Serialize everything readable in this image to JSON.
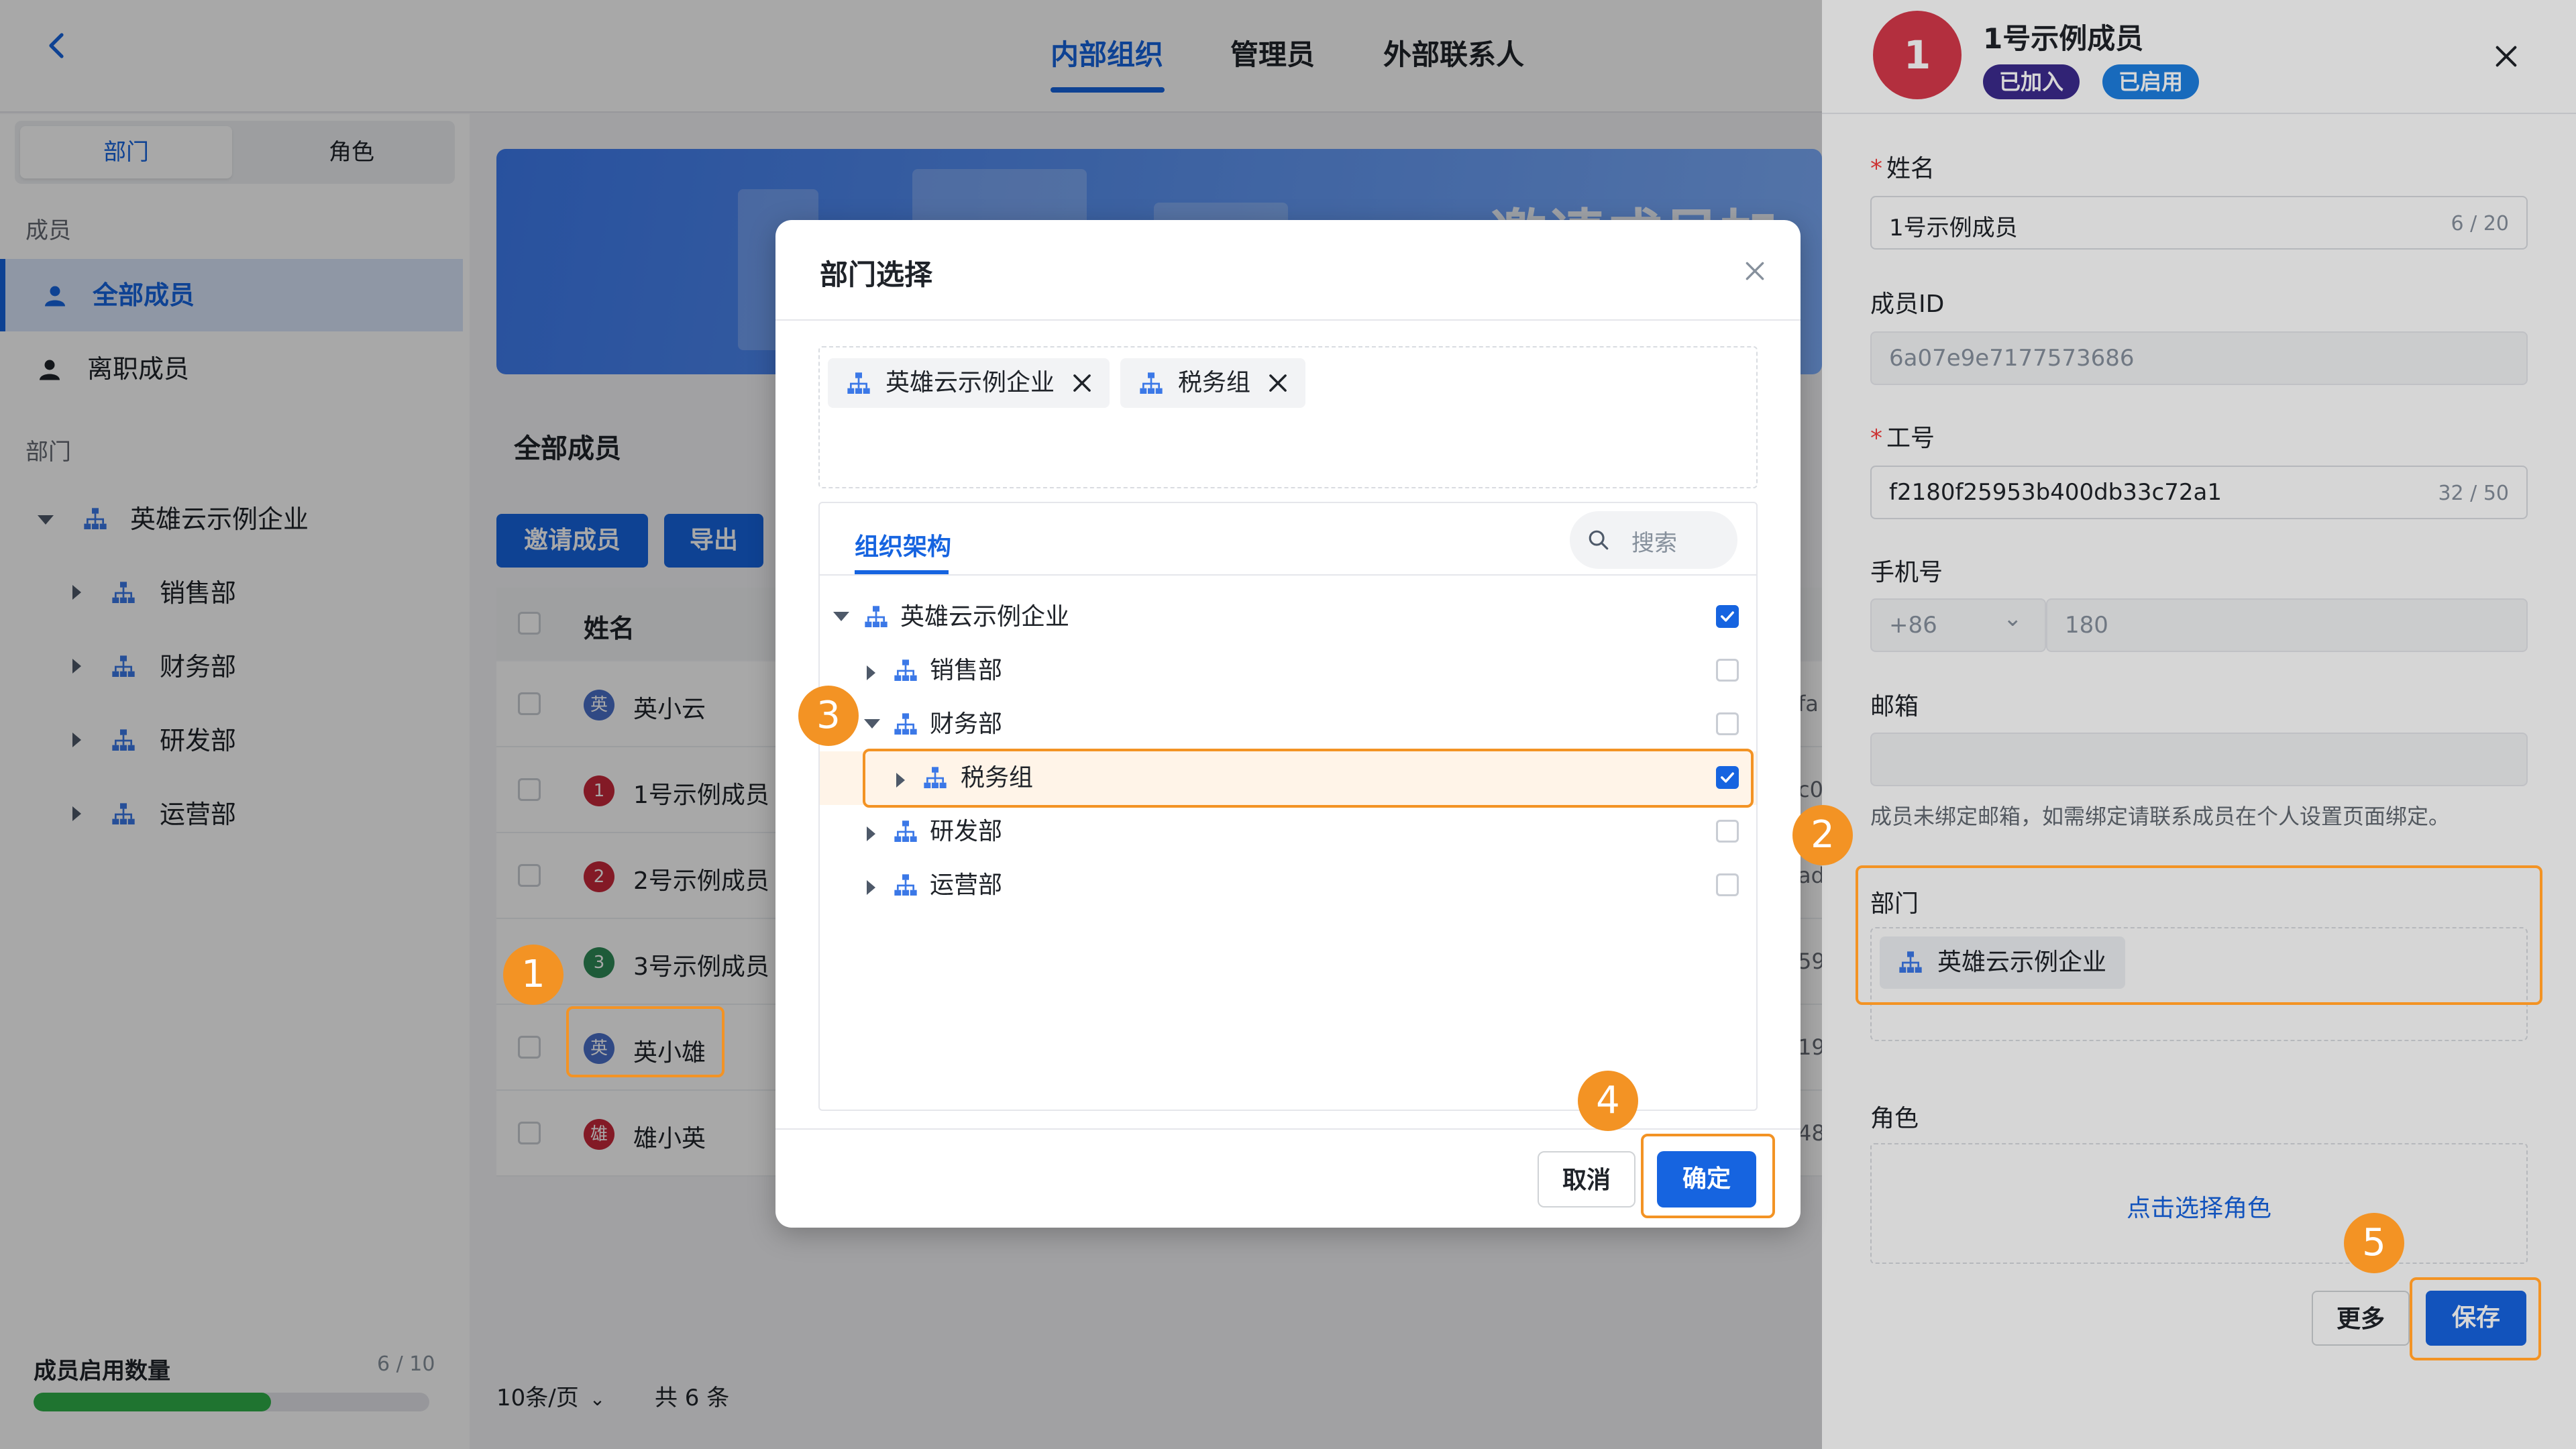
{
  "topbar": {
    "tabs": [
      "内部组织",
      "管理员",
      "外部联系人"
    ],
    "active_tab": "内部组织"
  },
  "sidebar": {
    "segments": {
      "dept": "部门",
      "role": "角色"
    },
    "members_label": "成员",
    "items": [
      {
        "label": "全部成员"
      },
      {
        "label": "离职成员"
      }
    ],
    "dept_label": "部门",
    "root": "英雄云示例企业",
    "children": [
      "销售部",
      "财务部",
      "研发部",
      "运营部"
    ],
    "quota_label": "成员启用数量",
    "quota_value": "6 / 10",
    "quota_fraction": 0.6
  },
  "main": {
    "banner_text": "邀请成员加入",
    "section_title": "全部成员",
    "invite_button": "邀请成员",
    "export_button": "导出",
    "column_name": "姓名",
    "rows": [
      {
        "avatar": "英",
        "name": "英小云",
        "extra": "fa",
        "color": "#4a6fc9"
      },
      {
        "avatar": "1",
        "name": "1号示例成员",
        "extra": "c0",
        "color": "#c7283a"
      },
      {
        "avatar": "2",
        "name": "2号示例成员",
        "extra": "ad",
        "color": "#c7283a"
      },
      {
        "avatar": "3",
        "name": "3号示例成员",
        "extra": "59",
        "color": "#2e8b57"
      },
      {
        "avatar": "英",
        "name": "英小雄",
        "extra": "19",
        "color": "#4a6fc9"
      },
      {
        "avatar": "雄",
        "name": "雄小英",
        "extra": "48",
        "color": "#c7283a"
      }
    ],
    "page_size": "10条/页",
    "total": "共 6 条"
  },
  "modal": {
    "title": "部门选择",
    "selected_chips": [
      "英雄云示例企业",
      "税务组"
    ],
    "tab_label": "组织架构",
    "search_placeholder": "搜索",
    "tree": [
      {
        "label": "英雄云示例企业",
        "checked": true
      },
      {
        "label": "销售部",
        "checked": false
      },
      {
        "label": "财务部",
        "checked": false
      },
      {
        "label": "税务组",
        "checked": true
      },
      {
        "label": "研发部",
        "checked": false
      },
      {
        "label": "运营部",
        "checked": false
      }
    ],
    "cancel": "取消",
    "confirm": "确定"
  },
  "panel": {
    "avatar": "1",
    "name": "1号示例成员",
    "tags": [
      "已加入",
      "已启用"
    ],
    "fields": {
      "name_label": "姓名",
      "name_value": "1号示例成员",
      "name_count": "6 / 20",
      "id_label": "成员ID",
      "id_value": "6a07e9e7177573686",
      "jobno_label": "工号",
      "jobno_value": "f2180f25953b400db33c72a1",
      "jobno_count": "32 / 50",
      "phone_label": "手机号",
      "phone_code": "+86",
      "phone_value": "180",
      "email_label": "邮箱",
      "email_hint": "成员未绑定邮箱，如需绑定请联系成员在个人设置页面绑定。",
      "dept_label": "部门",
      "dept_chip": "英雄云示例企业",
      "role_label": "角色",
      "role_link": "点击选择角色"
    },
    "more": "更多",
    "save": "保存"
  },
  "annotations": [
    "1",
    "2",
    "3",
    "4",
    "5"
  ],
  "colors": {
    "primary": "#1664e0",
    "annotation": "#f39324",
    "success": "#2fb14a"
  }
}
